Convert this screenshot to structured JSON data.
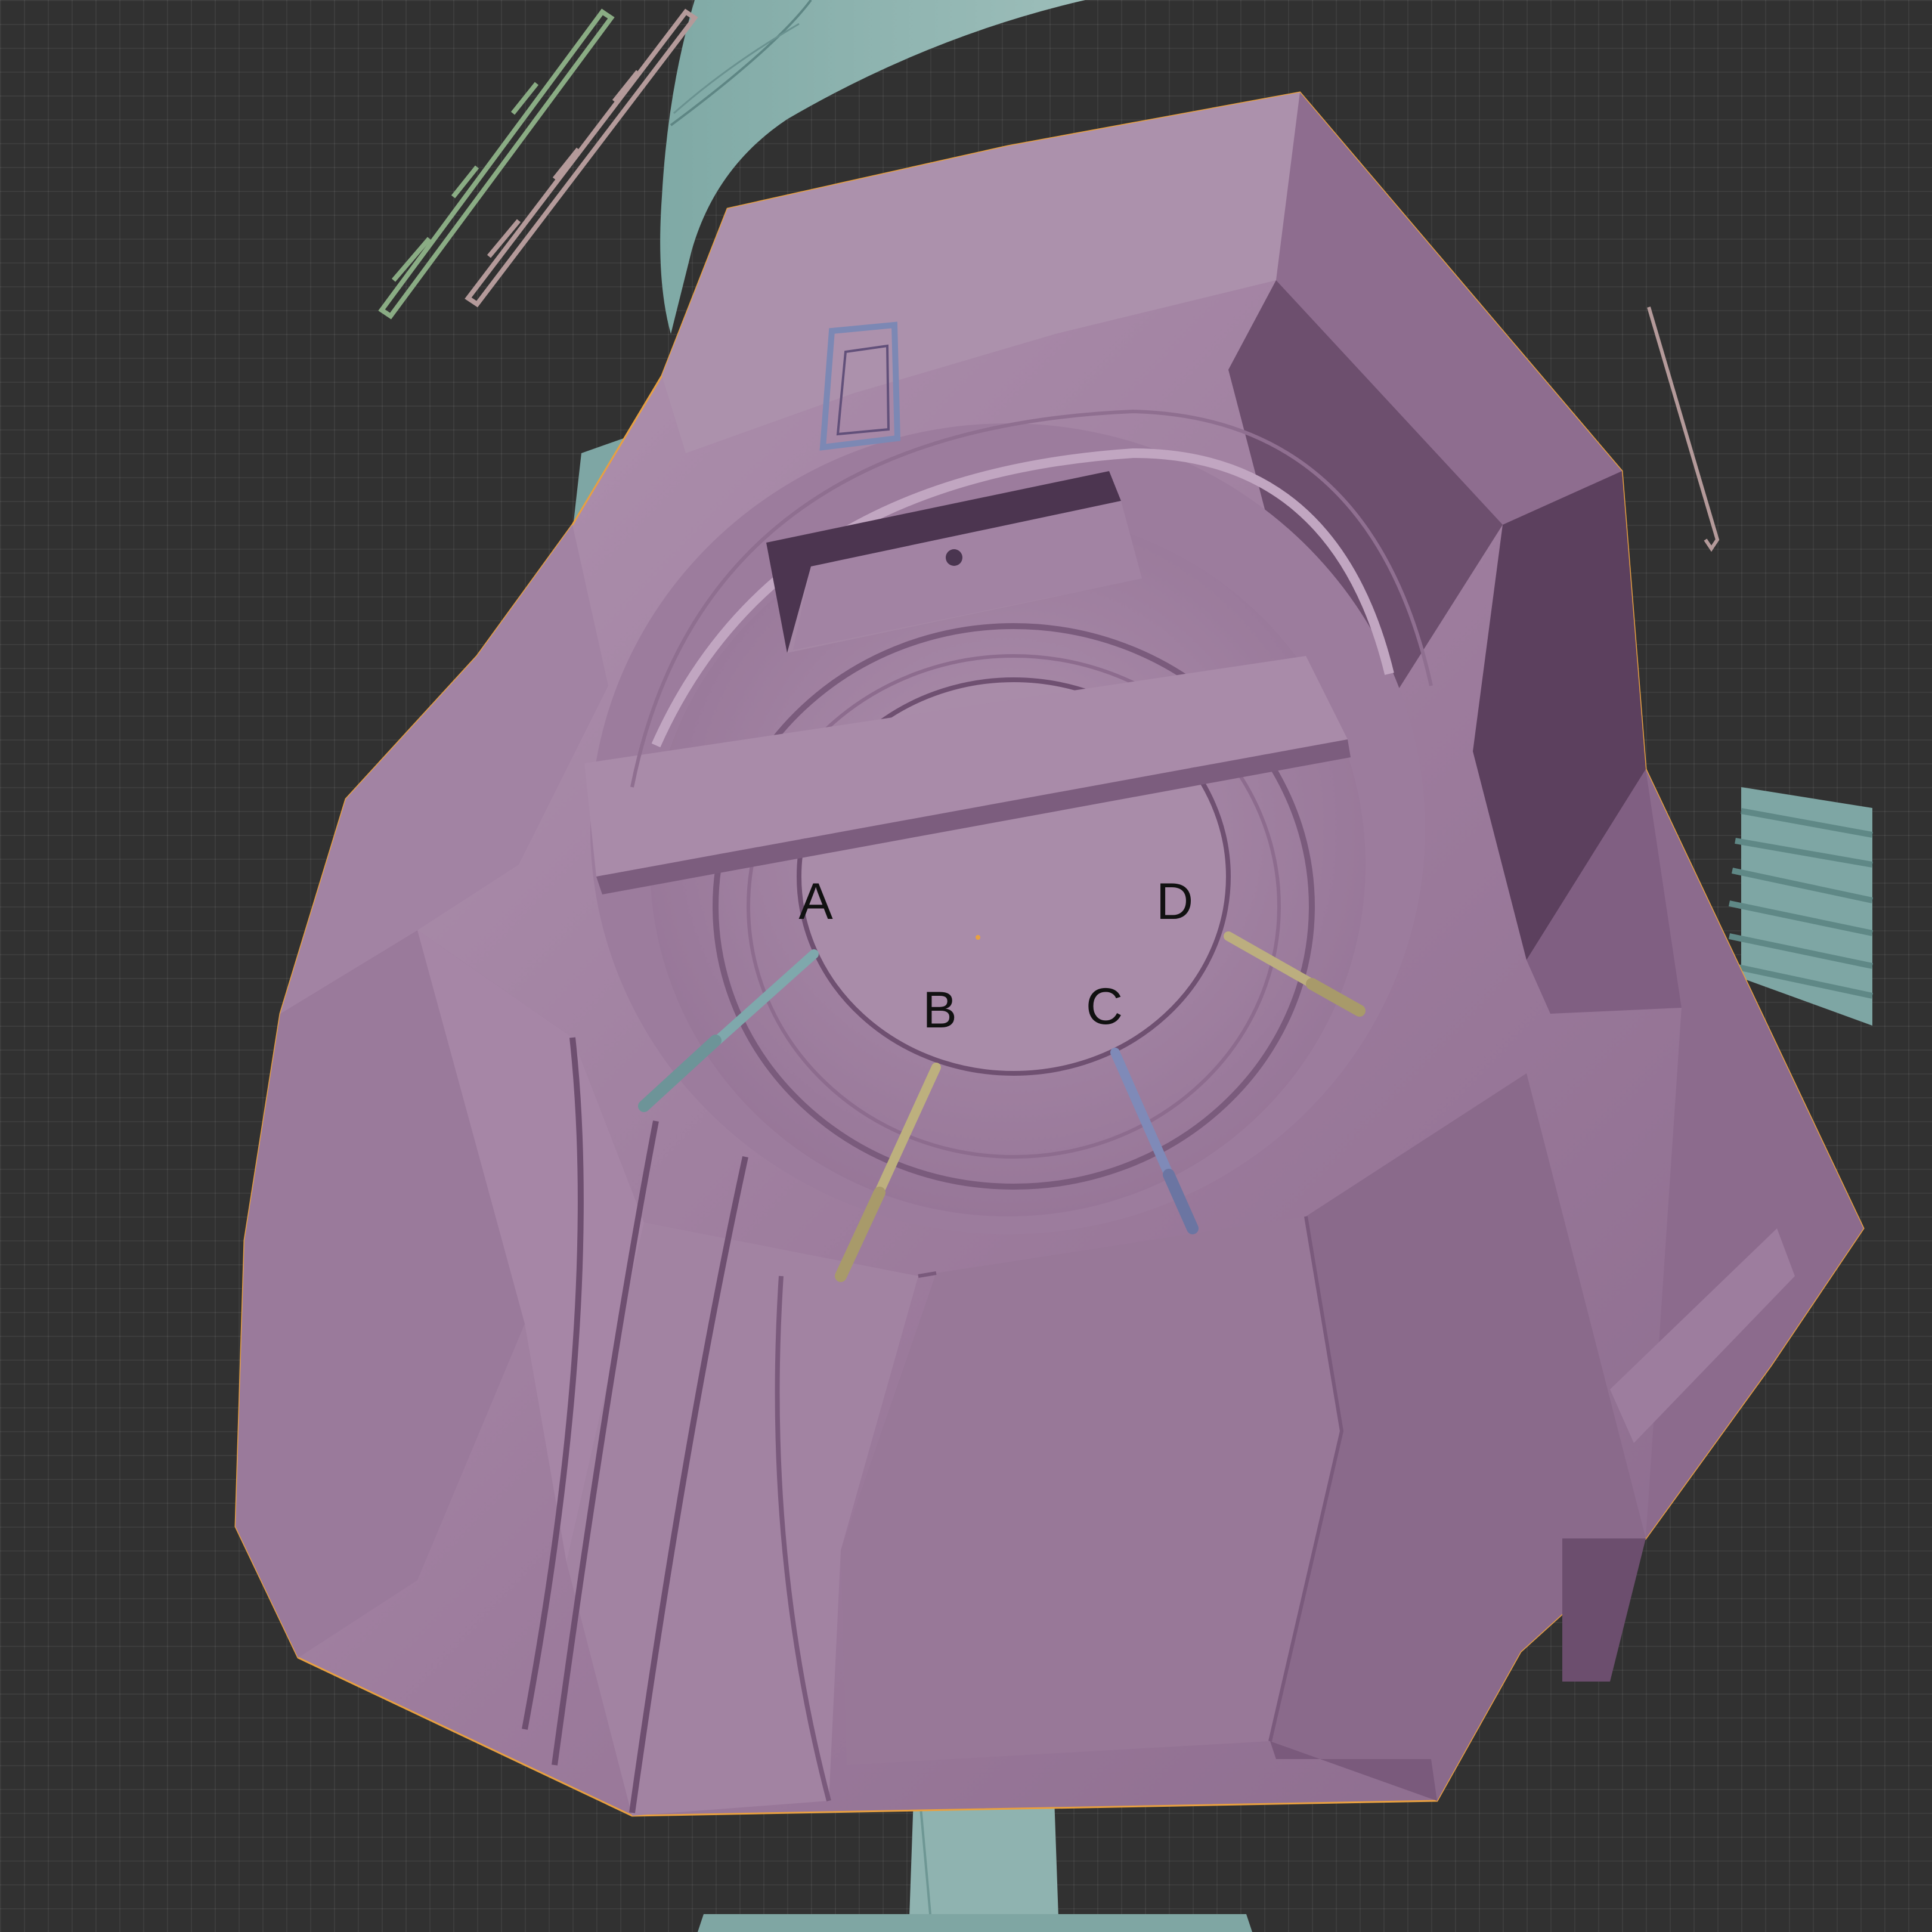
{
  "viewport": {
    "background_color": "#313131",
    "grid_visible": true
  },
  "model": {
    "main_shell_color": "#9b7a9b",
    "selection_outline_color": "#e8a040",
    "support_colors": [
      "#88b0ac",
      "#c0b080",
      "#7c88b4",
      "#88b4a8"
    ],
    "stray_part_colors": [
      "#8aac84",
      "#b49a9a"
    ]
  },
  "labels": {
    "a": "A",
    "b": "B",
    "c": "C",
    "d": "D"
  }
}
